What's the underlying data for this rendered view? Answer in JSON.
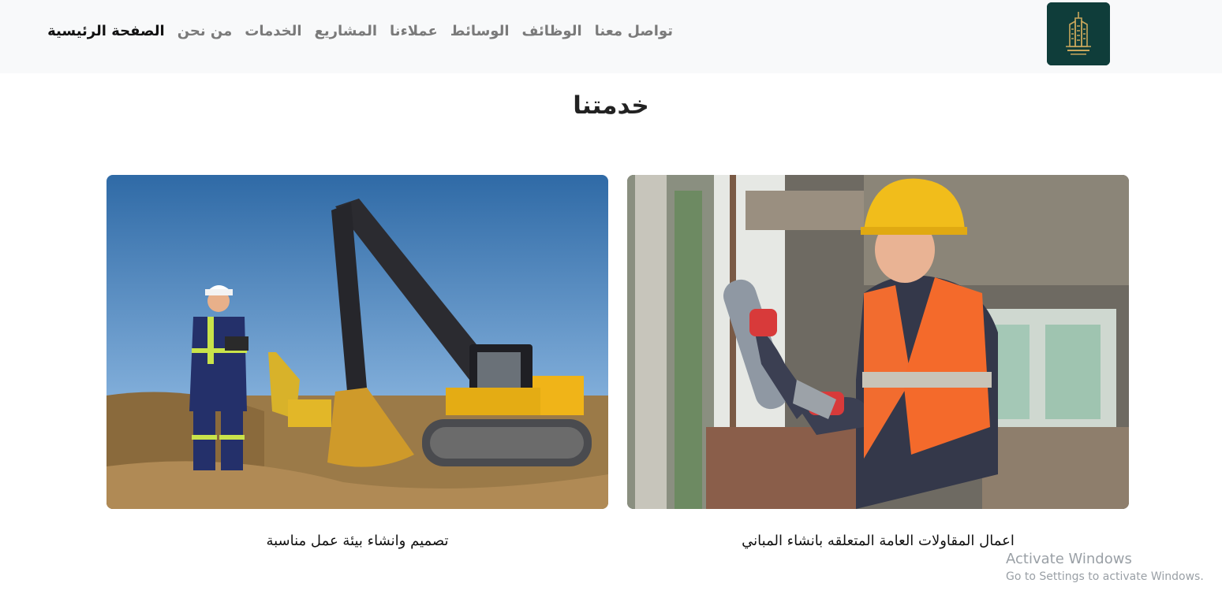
{
  "nav": {
    "logo_icon": "building-logo-icon",
    "links": [
      {
        "label": "الصفحة الرئيسية",
        "active": true
      },
      {
        "label": "من نحن"
      },
      {
        "label": "الخدمات"
      },
      {
        "label": "المشاريع"
      },
      {
        "label": "عملاءنا"
      },
      {
        "label": "الوسائط"
      },
      {
        "label": "الوظائف"
      },
      {
        "label": "تواصل معنا"
      }
    ]
  },
  "services": {
    "title": "خدمتنا",
    "cards": [
      {
        "caption": "اعمال المقاولات العامة المتعلقه بانشاء المباني",
        "image": "worker-with-caulk-gun-photo"
      },
      {
        "caption": "تصميم وانشاء بيئة عمل مناسبة",
        "image": "excavator-site-engineer-photo"
      }
    ]
  },
  "watermark": {
    "line1": "Activate Windows",
    "line2": "Go to Settings to activate Windows."
  },
  "colors": {
    "navbar_bg": "#f8f9fa",
    "logo_bg": "#0f3d3a",
    "logo_gold": "#c9a75c",
    "nav_active": "#111111",
    "nav_inactive": "#7a7a7a"
  }
}
